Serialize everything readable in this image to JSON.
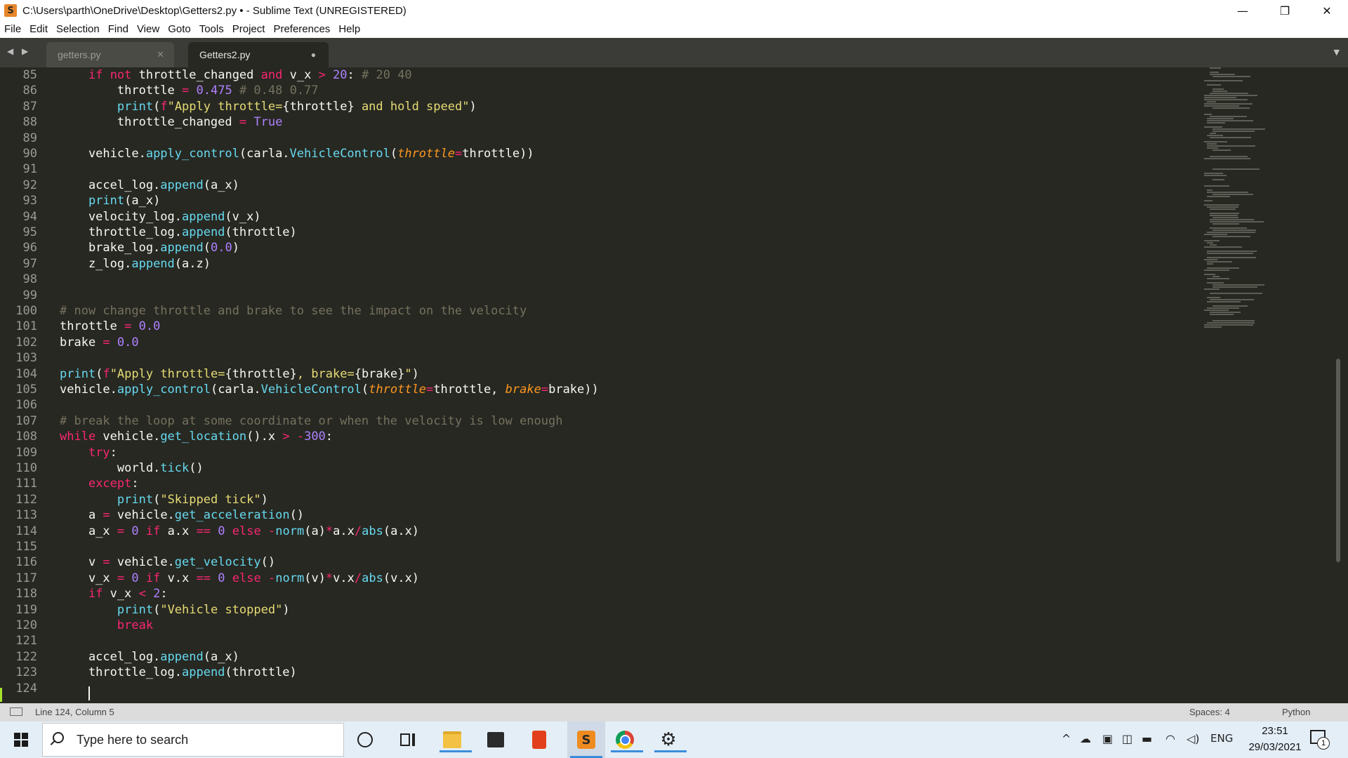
{
  "window": {
    "title": "C:\\Users\\parth\\OneDrive\\Desktop\\Getters2.py • - Sublime Text (UNREGISTERED)",
    "minimize": "—",
    "maximize": "❐",
    "close": "✕",
    "app_icon": "sublime-icon",
    "app_icon_glyph": "S"
  },
  "menu": {
    "items": [
      {
        "label": "File"
      },
      {
        "label": "Edit"
      },
      {
        "label": "Selection"
      },
      {
        "label": "Find"
      },
      {
        "label": "View"
      },
      {
        "label": "Goto"
      },
      {
        "label": "Tools"
      },
      {
        "label": "Project"
      },
      {
        "label": "Preferences"
      },
      {
        "label": "Help"
      }
    ]
  },
  "tabs": {
    "nav_arrows": "◀ ▶",
    "items": [
      {
        "label": "getters.py",
        "active": false,
        "close": "✕"
      },
      {
        "label": "Getters2.py",
        "active": true,
        "dirty": "●"
      }
    ],
    "dropdown": "▼"
  },
  "editor": {
    "line_numbers": [
      85,
      86,
      87,
      88,
      89,
      90,
      91,
      92,
      93,
      94,
      95,
      96,
      97,
      98,
      99,
      100,
      101,
      102,
      103,
      104,
      105,
      106,
      107,
      108,
      109,
      110,
      111,
      112,
      113,
      114,
      115,
      116,
      117,
      118,
      119,
      120,
      121,
      122,
      123,
      124
    ],
    "theme_colors": {
      "background": "#272822",
      "keyword": "#f92672",
      "string": "#e6db74",
      "number": "#ae81ff",
      "comment": "#75715e",
      "function": "#66d9ef",
      "parameter": "#fd971f"
    }
  },
  "status": {
    "position": "Line 124, Column 5",
    "indent": "Spaces: 4",
    "syntax": "Python"
  },
  "taskbar": {
    "search_placeholder": "Type here to search",
    "language": "ENG",
    "time": "23:51",
    "date": "29/03/2021",
    "notifications": "1",
    "pinned": [
      "cortana-icon",
      "task-view-icon",
      "file-explorer-icon",
      "store-icon",
      "office-icon",
      "sublime-text-icon",
      "chrome-icon",
      "settings-icon"
    ]
  }
}
